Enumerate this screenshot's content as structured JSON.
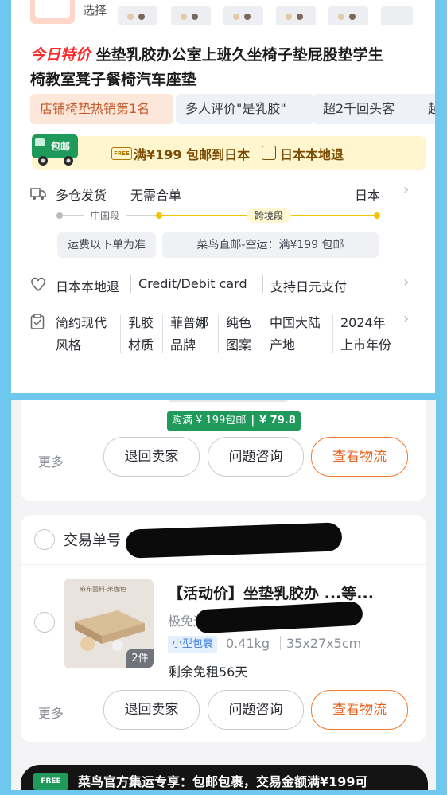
{
  "product": {
    "variant_label": "选择",
    "price_tag": "今日特价",
    "title": "坐垫乳胶办公室上班久坐椅子垫屁股垫学生椅教室凳子餐椅汽车座垫",
    "title_line1": "坐垫乳胶办公室上班久坐椅子垫屁股垫学生",
    "title_line2": "椅教室凳子餐椅汽车座垫",
    "chips": [
      "店铺椅垫热销第1名",
      "多人评价\"是乳胶\"",
      "超2千回头客",
      "超"
    ]
  },
  "shipping_banner": {
    "truck_label": "包邮",
    "free_tag": "FREE",
    "offer": "满¥199 包邮到日本",
    "return": "日本本地退"
  },
  "delivery": {
    "warehouse": "多仓发货",
    "no_merge": "无需合单",
    "destination": "日本",
    "segment_cn": "中国段",
    "segment_cross": "跨境段",
    "fee_note": "运费以下单为准",
    "route": "菜鸟直邮-空运：满¥199 包邮"
  },
  "services": {
    "return": "日本本地退",
    "card": "Credit/Debit card",
    "jpy": "支持日元支付"
  },
  "attributes": [
    {
      "value": "简约现代",
      "key": "风格"
    },
    {
      "value": "乳胶",
      "key": "材质"
    },
    {
      "value": "菲普娜",
      "key": "品牌"
    },
    {
      "value": "纯色",
      "key": "图案"
    },
    {
      "value": "中国大陆",
      "key": "产地"
    },
    {
      "value": "2024年",
      "key": "上市年份"
    }
  ],
  "order1": {
    "promo_left": "购满 ¥ 199包邮",
    "promo_right": "¥ 79.8",
    "more": "更多",
    "btn_return": "退回卖家",
    "btn_ask": "问题咨询",
    "btn_logistics": "查看物流"
  },
  "order2": {
    "trade_label": "交易单号",
    "item_title": "【活动价】坐垫乳胶办 ...等...",
    "shipping_prefix": "极免运",
    "size_tag": "小型包裹",
    "weight": "0.41kg",
    "dims": "35x27x5cm",
    "free_rent": "剩余免租56天",
    "qty": "2件",
    "img_caption": "麻布面料-米咖色",
    "more": "更多",
    "btn_return": "退回卖家",
    "btn_ask": "问题咨询",
    "btn_logistics": "查看物流"
  },
  "footer_banner": {
    "free_tag": "FREE",
    "text": "菜鸟官方集运专享：包邮包裹，交易金额满¥199可"
  },
  "colors": {
    "frame": "#6ec8ee",
    "accent_red": "#ff2a2a",
    "accent_orange": "#e8601a",
    "promo_green": "#1f9a5b",
    "route_yellow": "#f2c300"
  }
}
